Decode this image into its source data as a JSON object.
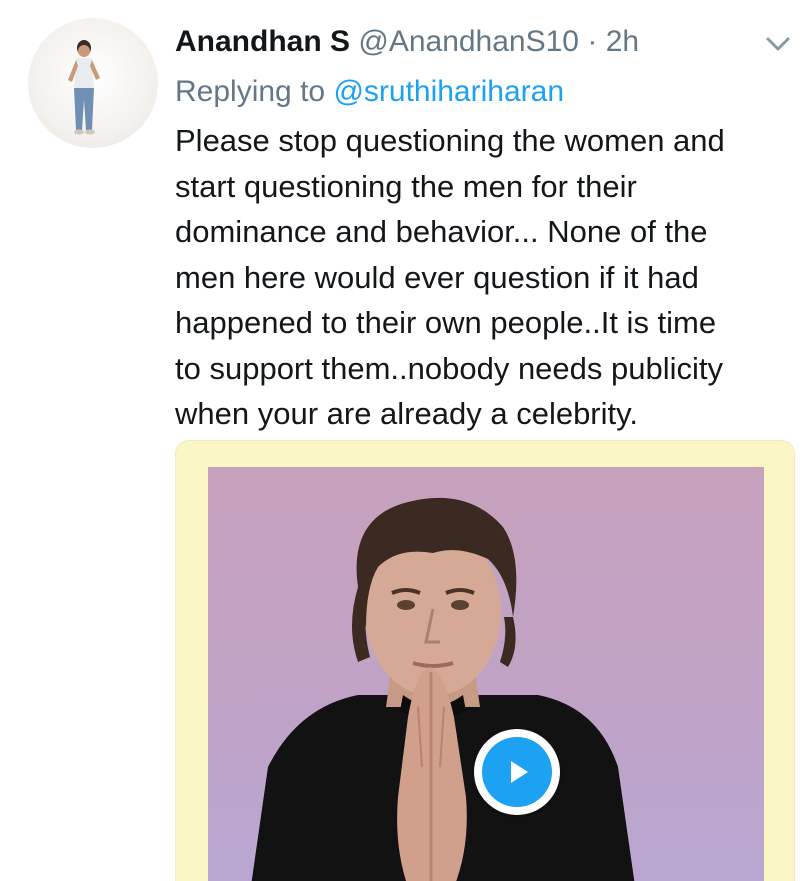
{
  "tweet": {
    "display_name": "Anandhan S",
    "handle": "@AnandhanS10",
    "separator": "·",
    "time": "2h",
    "replying_prefix": "Replying to ",
    "replying_to": "@sruthihariharan",
    "text_lines": [
      "Please stop questioning the women and",
      "start questioning the men for their",
      "dominance and behavior... None of the",
      "men here would ever question if it had",
      "happened to their own people..It is time",
      "to support them..nobody needs publicity",
      "when your are already a celebrity."
    ]
  },
  "icons": {
    "menu": "chevron-down-icon",
    "media_control": "play-icon"
  },
  "colors": {
    "link": "#1da1f2",
    "secondary_text": "#657786",
    "primary_text": "#14171a",
    "media_card_bg": "#faf7c4",
    "play_button": "#1da1f2"
  }
}
